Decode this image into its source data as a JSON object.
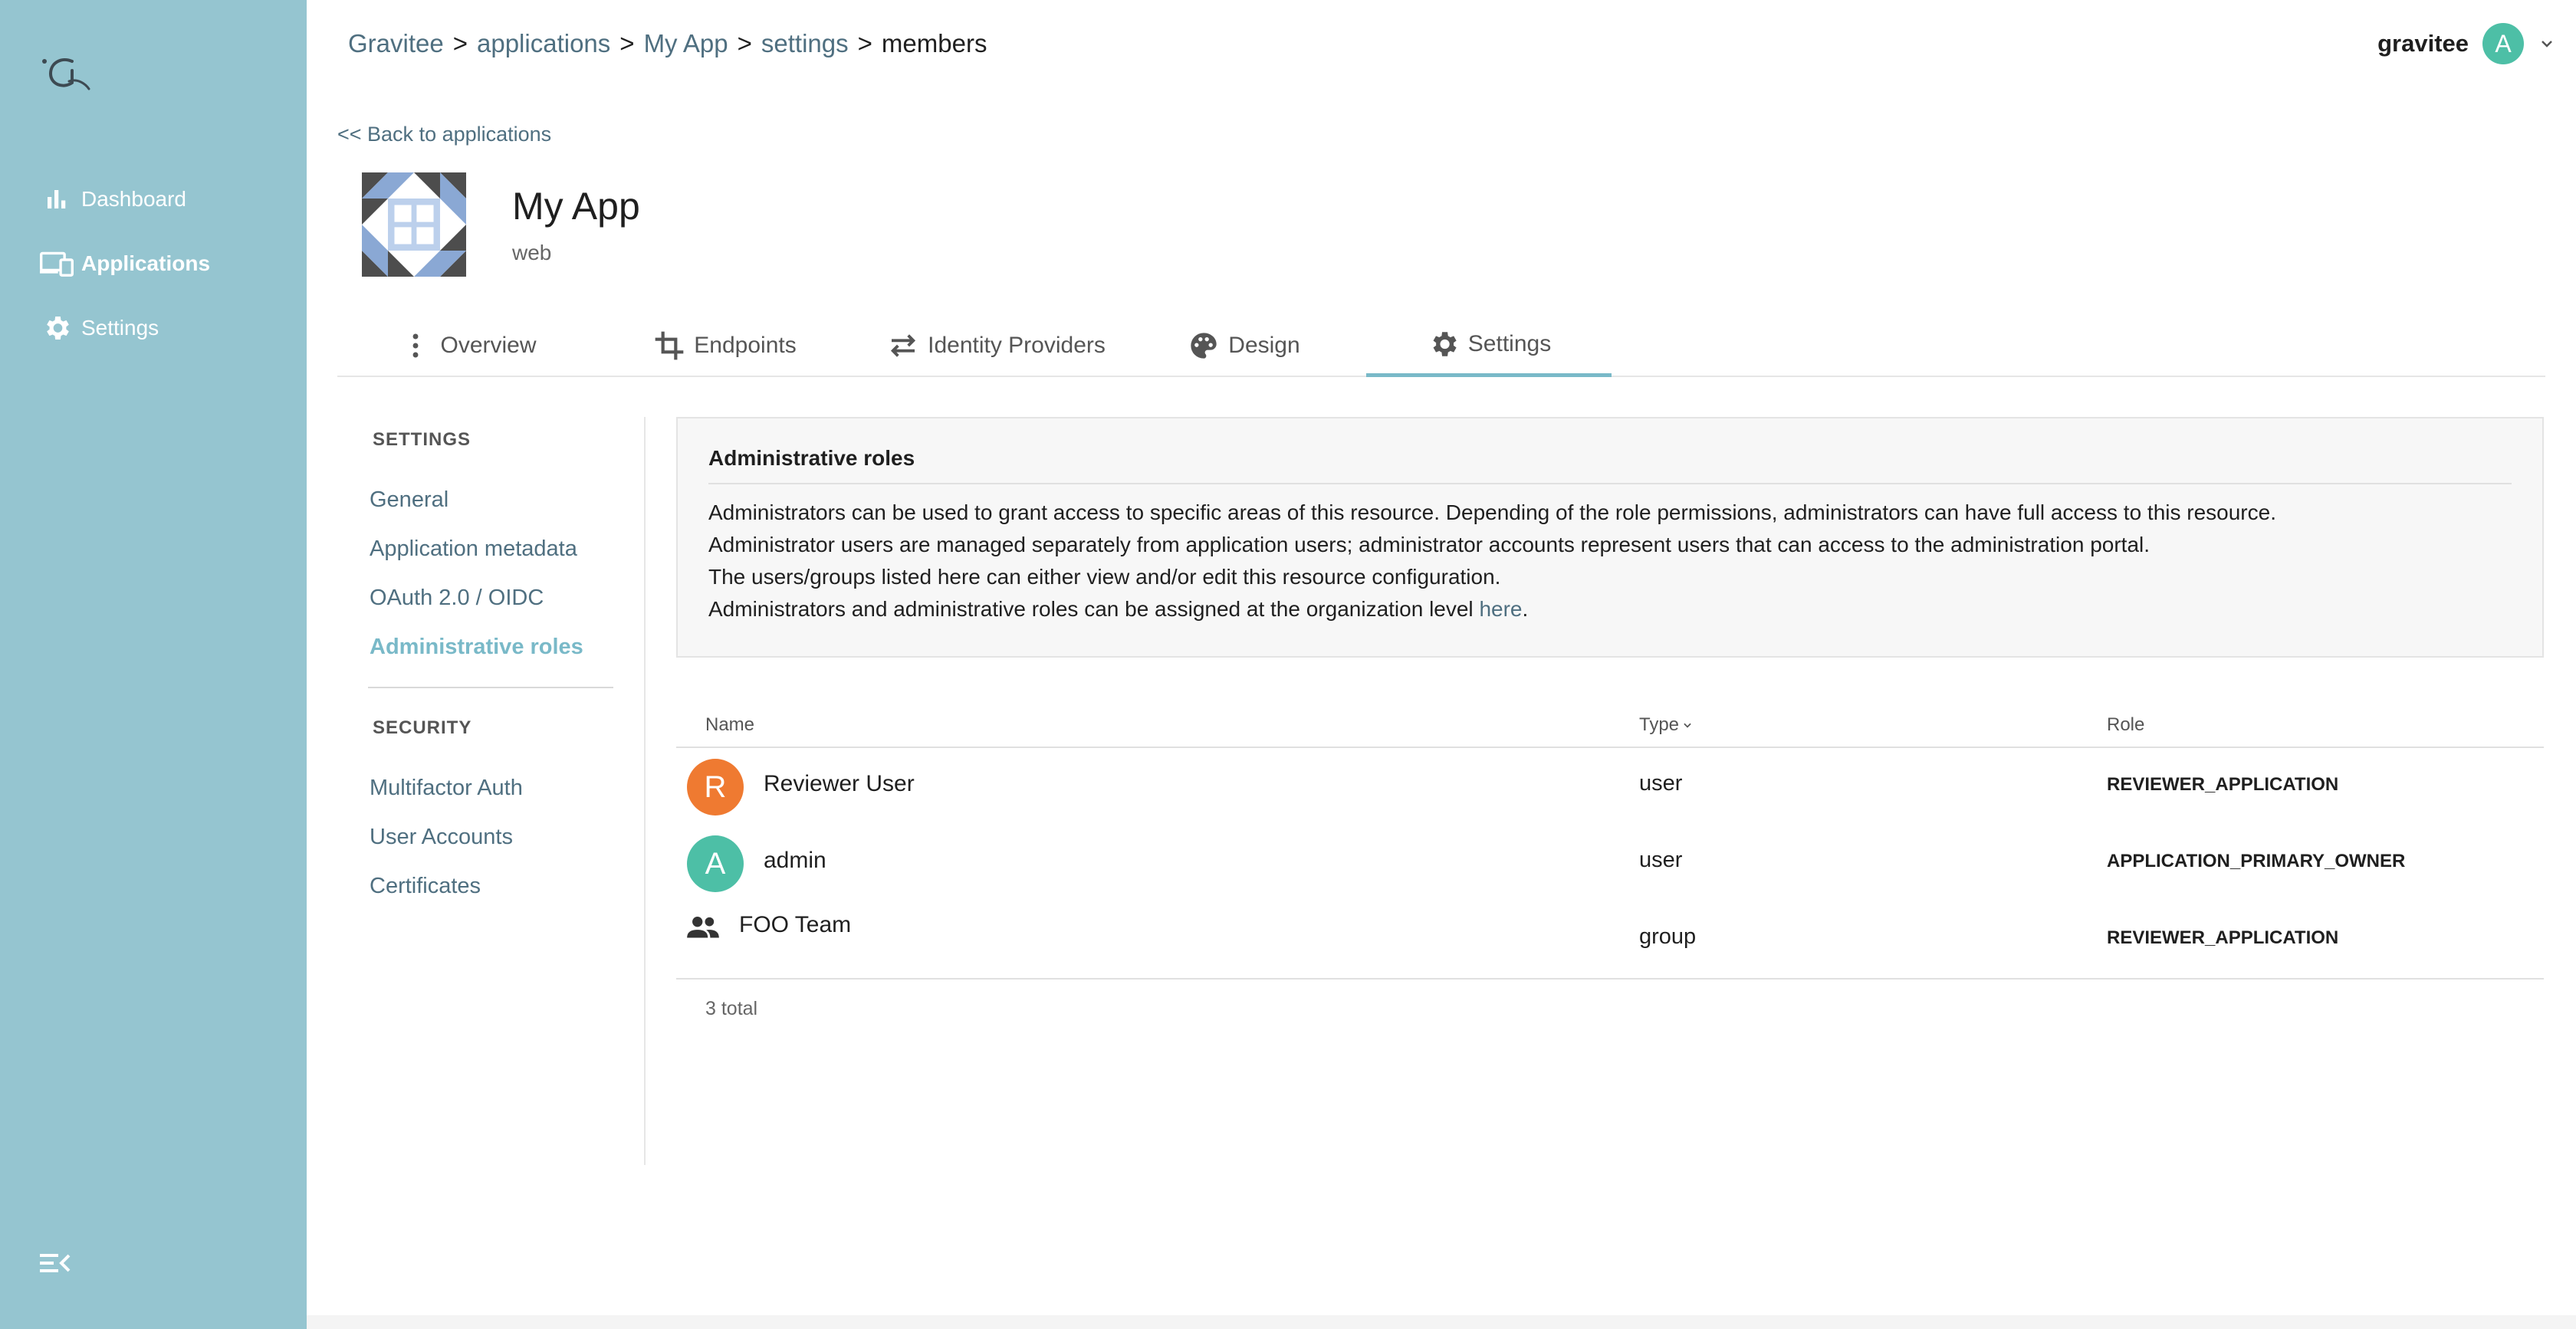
{
  "sidebar": {
    "items": [
      {
        "label": "Dashboard",
        "icon": "bar-chart-icon"
      },
      {
        "label": "Applications",
        "icon": "devices-icon"
      },
      {
        "label": "Settings",
        "icon": "gear-icon"
      }
    ],
    "colors": {
      "background": "#95c5d0",
      "text": "#ffffff"
    }
  },
  "breadcrumb": {
    "items": [
      "Gravitee",
      "applications",
      "My App",
      "settings",
      "members"
    ],
    "separator": ">"
  },
  "user": {
    "name": "gravitee",
    "avatar_letter": "A",
    "avatar_color": "#4dbfa6"
  },
  "back_link": "<< Back to applications",
  "app": {
    "name": "My App",
    "type": "web"
  },
  "tabs": [
    {
      "label": "Overview",
      "icon": "more-vert-icon"
    },
    {
      "label": "Endpoints",
      "icon": "crop-icon"
    },
    {
      "label": "Identity Providers",
      "icon": "swap-icon"
    },
    {
      "label": "Design",
      "icon": "palette-icon"
    },
    {
      "label": "Settings",
      "icon": "gear-icon",
      "active": true
    }
  ],
  "settings_nav": {
    "settings_heading": "SETTINGS",
    "settings_items": [
      "General",
      "Application metadata",
      "OAuth 2.0 / OIDC",
      "Administrative roles"
    ],
    "active_item": "Administrative roles",
    "security_heading": "SECURITY",
    "security_items": [
      "Multifactor Auth",
      "User Accounts",
      "Certificates"
    ]
  },
  "info_panel": {
    "title": "Administrative roles",
    "lines": [
      "Administrators can be used to grant access to specific areas of this resource. Depending of the role permissions, administrators can have full access to this resource.",
      "Administrator users are managed separately from application users; administrator accounts represent users that can access to the administration portal.",
      "The users/groups listed here can either view and/or edit this resource configuration."
    ],
    "last_line_prefix": "Administrators and administrative roles can be assigned at the organization level ",
    "last_line_link": "here",
    "last_line_suffix": "."
  },
  "table": {
    "columns": {
      "name": "Name",
      "type": "Type",
      "role": "Role"
    },
    "rows": [
      {
        "avatar_letter": "R",
        "avatar_color": "#ef7a31",
        "name": "Reviewer User",
        "type": "user",
        "role": "REVIEWER_APPLICATION"
      },
      {
        "avatar_letter": "A",
        "avatar_color": "#4dbfa6",
        "name": "admin",
        "type": "user",
        "role": "APPLICATION_PRIMARY_OWNER"
      },
      {
        "icon": "group-icon",
        "name": "FOO Team",
        "type": "group",
        "role": "REVIEWER_APPLICATION"
      }
    ],
    "total": "3 total"
  }
}
